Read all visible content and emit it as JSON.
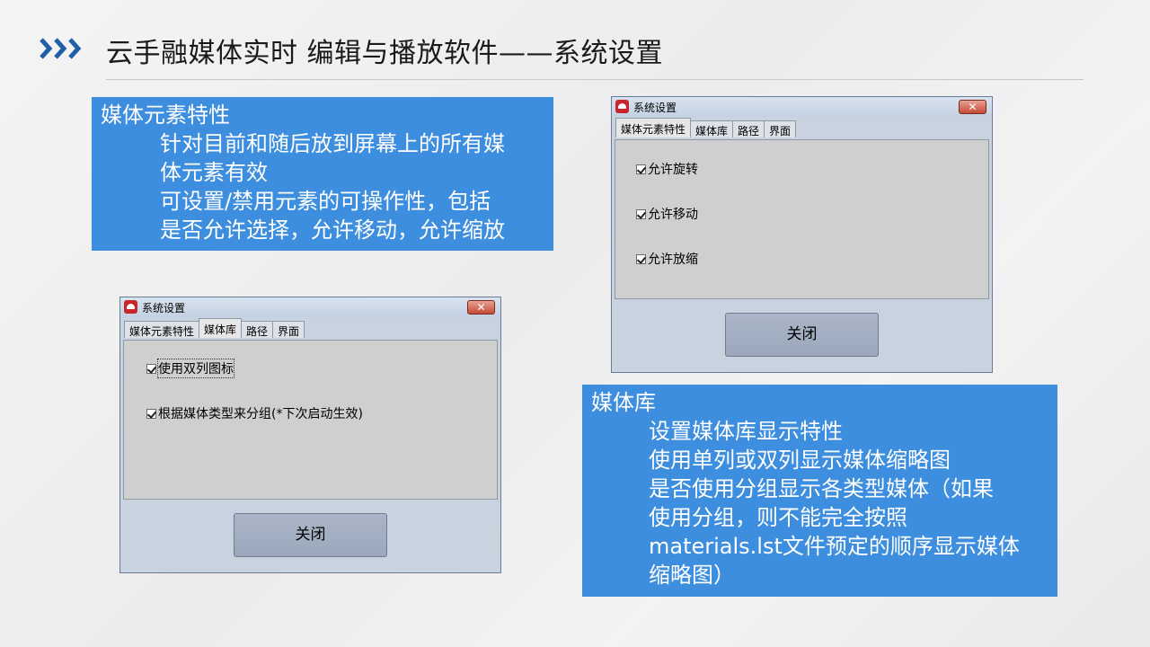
{
  "header": {
    "title": "云手融媒体实时 编辑与播放软件——系统设置"
  },
  "info_elements": {
    "heading": "媒体元素特性",
    "lines": [
      "针对目前和随后放到屏幕上的所有媒",
      "体元素有效",
      "可设置/禁用元素的可操作性，包括",
      "是否允许选择，允许移动，允许缩放"
    ]
  },
  "info_library": {
    "heading": "媒体库",
    "lines": [
      "设置媒体库显示特性",
      "使用单列或双列显示媒体缩略图",
      "是否使用分组显示各类型媒体（如果",
      "使用分组，则不能完全按照",
      "materials.lst文件预定的顺序显示媒体",
      "缩略图）"
    ]
  },
  "dialog_elements": {
    "title": "系统设置",
    "close_glyph": "✕",
    "tabs": [
      "媒体元素特性",
      "媒体库",
      "路径",
      "界面"
    ],
    "active_tab": "媒体元素特性",
    "checkboxes": [
      {
        "label": "允许旋转",
        "checked": true
      },
      {
        "label": "允许移动",
        "checked": true
      },
      {
        "label": "允许放缩",
        "checked": true
      }
    ],
    "close_button": "关闭"
  },
  "dialog_library": {
    "title": "系统设置",
    "close_glyph": "✕",
    "tabs": [
      "媒体元素特性",
      "媒体库",
      "路径",
      "界面"
    ],
    "active_tab": "媒体库",
    "checkboxes": [
      {
        "label": "使用双列图标",
        "checked": true
      },
      {
        "label": "根据媒体类型来分组(*下次启动生效)",
        "checked": true
      }
    ],
    "close_button": "关闭"
  },
  "colors": {
    "accent_blue": "#3d8ede",
    "chevron_blue": "#1f5fa8",
    "close_red": "#c44a35"
  },
  "icons": {
    "header": "chevron-right-triple-icon",
    "dialog": "app-logo-icon"
  }
}
